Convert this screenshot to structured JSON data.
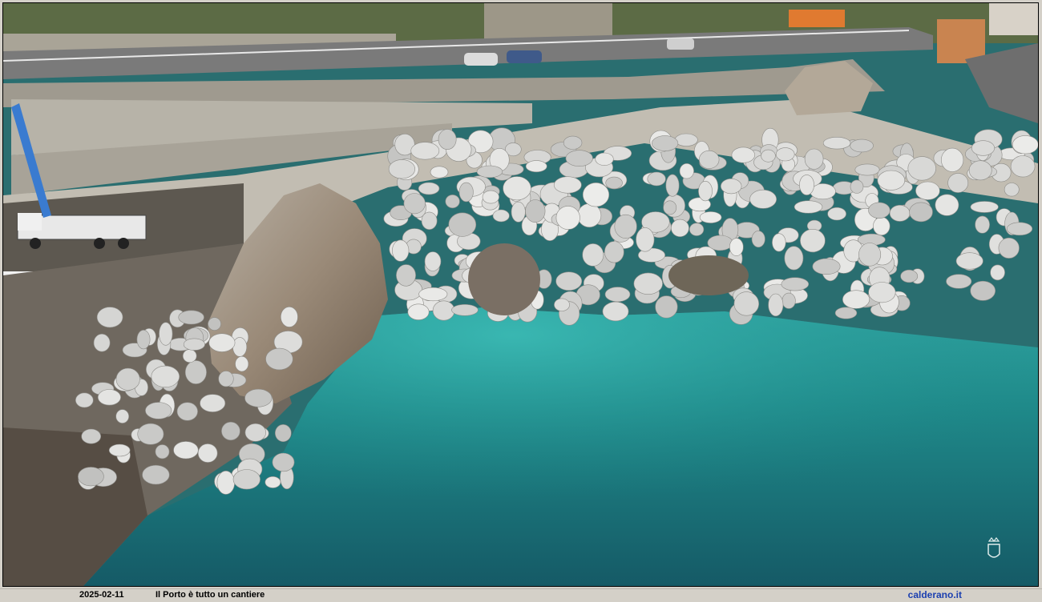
{
  "caption": {
    "date": "2025-02-11",
    "title": "Il Porto è tutto un cantiere",
    "site": "calderano.it"
  },
  "photo": {
    "subject": "aerial-coastline-construction",
    "watermark_icon": "crest-icon"
  },
  "colors": {
    "sea_deep": "#1a5f66",
    "sea_shallow": "#2fa3a0",
    "rock": "#8a7f72",
    "boulder": "#e6e6e4",
    "road": "#7c7c7c",
    "site_link": "#1b3fb0"
  }
}
